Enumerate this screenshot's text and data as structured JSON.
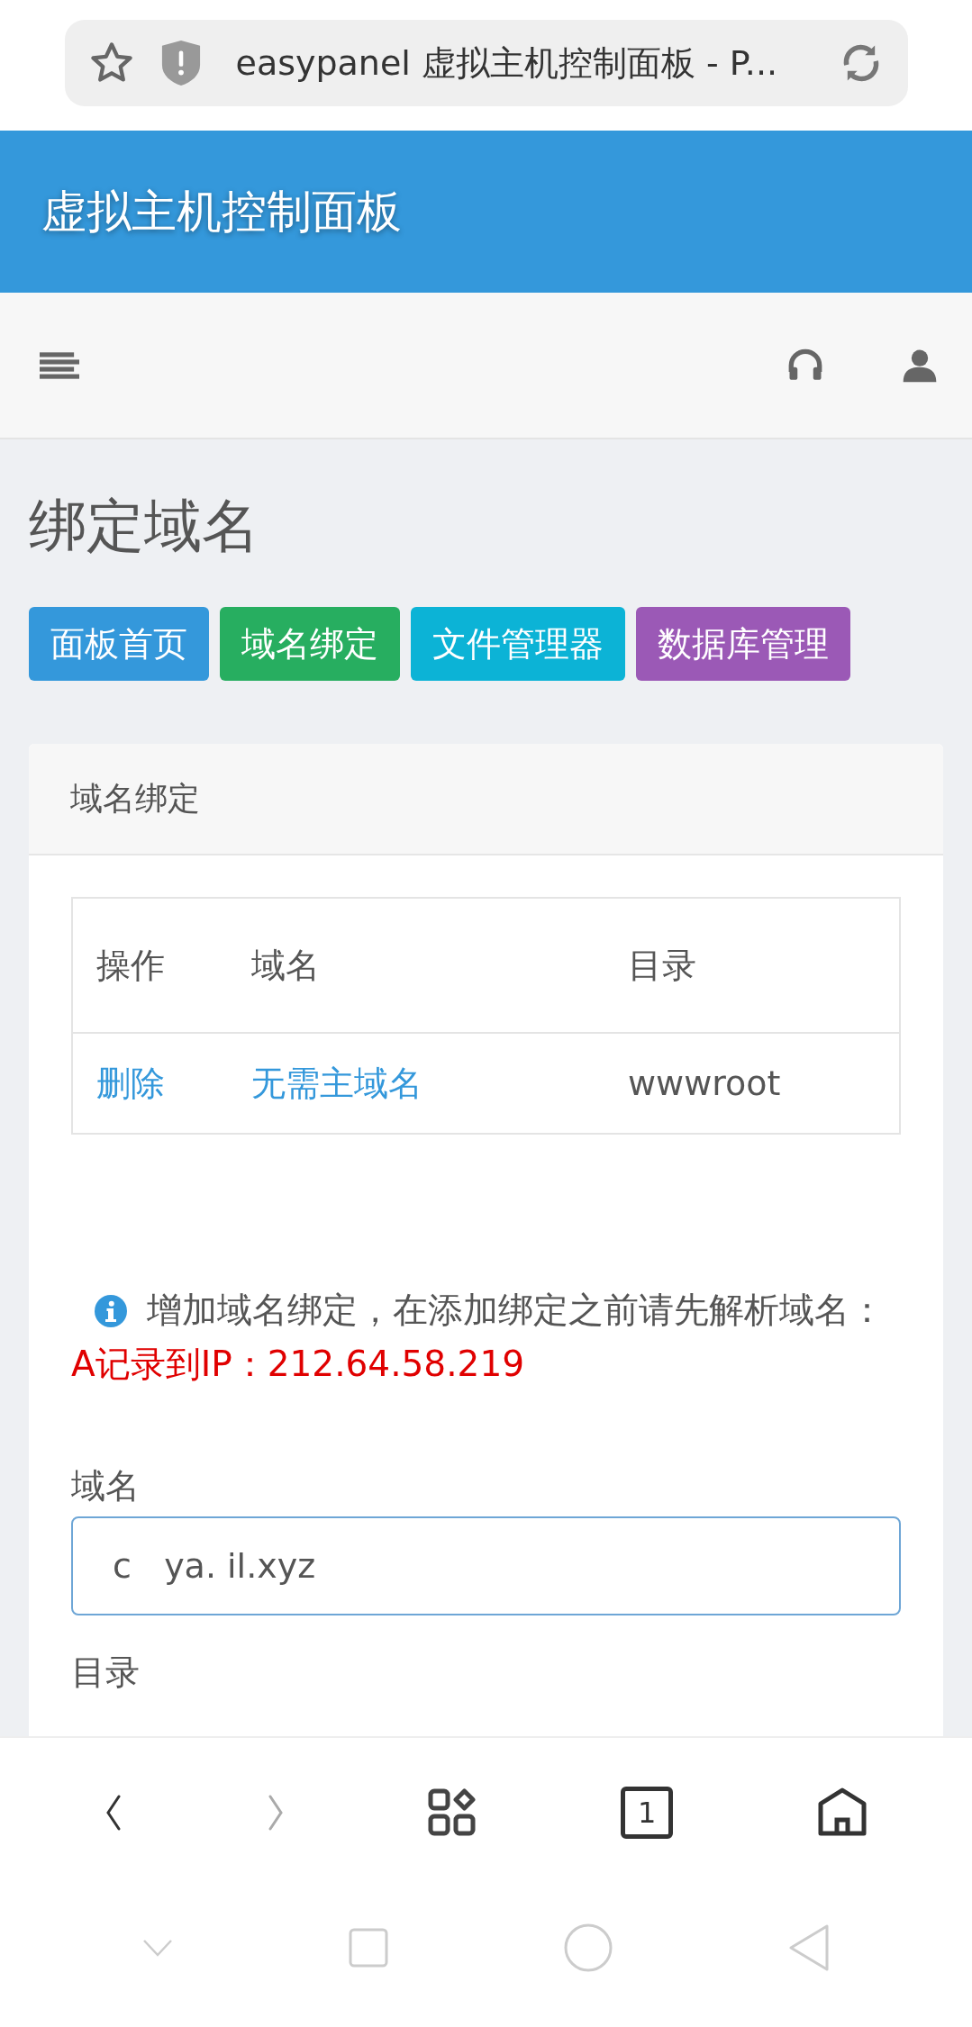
{
  "browser": {
    "page_title": "easypanel 虚拟主机控制面板 - P..."
  },
  "header": {
    "title": "虚拟主机控制面板"
  },
  "page": {
    "heading": "绑定域名",
    "nav_buttons": [
      {
        "label": "面板首页",
        "color": "#3498db"
      },
      {
        "label": "域名绑定",
        "color": "#27ae60"
      },
      {
        "label": "文件管理器",
        "color": "#0cb3d6"
      },
      {
        "label": "数据库管理",
        "color": "#9b59b6"
      }
    ]
  },
  "card": {
    "title": "域名绑定",
    "table": {
      "columns": [
        "操作",
        "域名",
        "目录"
      ],
      "rows": [
        [
          "删除",
          "无需主域名",
          "wwwroot"
        ]
      ]
    },
    "notice": {
      "text": "增加域名绑定，在添加绑定之前请先解析域名：",
      "highlight": "A记录到IP：212.64.58.219"
    },
    "form": [
      {
        "label": "域名",
        "value": "c   ya. il.xyz"
      },
      {
        "label": "目录"
      }
    ]
  },
  "bottom_bar": {
    "tab_count": "1"
  }
}
